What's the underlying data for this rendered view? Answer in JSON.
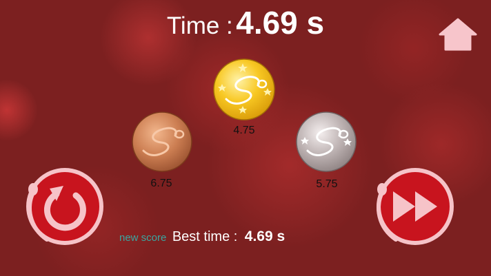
{
  "header": {
    "time_label": "Time :",
    "time_value": "4.69 s"
  },
  "medals": {
    "gold": {
      "value": "4.75",
      "color": "#f5c21c"
    },
    "bronze": {
      "value": "6.75",
      "color": "#c87a50"
    },
    "silver": {
      "value": "5.75",
      "color": "#b9aeae"
    }
  },
  "footer": {
    "new_score_label": "new score",
    "best_label": "Best time :",
    "best_value": "4.69 s"
  },
  "buttons": {
    "home_icon": "home-icon",
    "restart_icon": "restart-icon",
    "next_icon": "fast-forward-icon"
  },
  "colors": {
    "background": "#7c2020",
    "button_fill": "#c8141e",
    "button_ring": "#f6c3c8",
    "new_score": "#3aa6a0"
  }
}
